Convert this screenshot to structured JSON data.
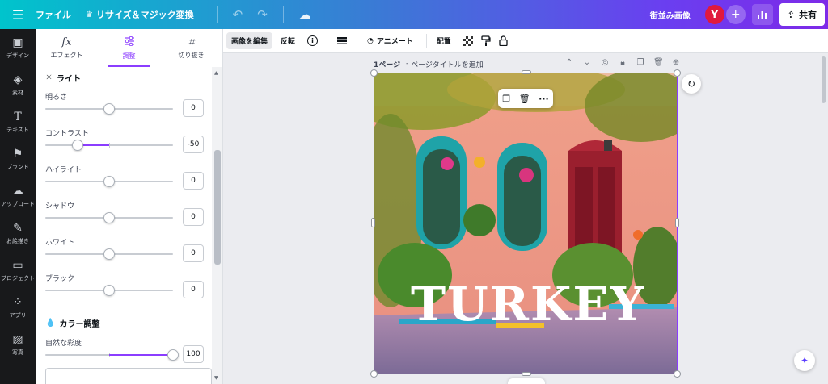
{
  "topbar": {
    "file_label": "ファイル",
    "resize_label": "リサイズ＆マジック変換",
    "design_title": "街並み画像",
    "avatar_initial": "Y",
    "share_label": "共有"
  },
  "rail": [
    {
      "label": "デザイン",
      "icon": "layout-icon"
    },
    {
      "label": "素材",
      "icon": "elements-icon"
    },
    {
      "label": "テキスト",
      "icon": "text-icon"
    },
    {
      "label": "ブランド",
      "icon": "brand-icon"
    },
    {
      "label": "アップロード",
      "icon": "upload-icon"
    },
    {
      "label": "お絵描き",
      "icon": "draw-icon"
    },
    {
      "label": "プロジェクト",
      "icon": "folder-icon"
    },
    {
      "label": "アプリ",
      "icon": "apps-icon"
    },
    {
      "label": "写真",
      "icon": "photo-icon"
    }
  ],
  "panel": {
    "tabs": [
      {
        "label": "エフェクト",
        "icon": "fx"
      },
      {
        "label": "調整",
        "icon": "sliders-icon"
      },
      {
        "label": "切り抜き",
        "icon": "crop-icon"
      }
    ],
    "active_tab": 1,
    "light_section": "ライト",
    "color_section": "カラー調整",
    "sliders": [
      {
        "label": "明るさ",
        "value": "0",
        "level": 0
      },
      {
        "label": "コントラスト",
        "value": "-50",
        "level": -50
      },
      {
        "label": "ハイライト",
        "value": "0",
        "level": 0
      },
      {
        "label": "シャドウ",
        "value": "0",
        "level": 0
      },
      {
        "label": "ホワイト",
        "value": "0",
        "level": 0
      },
      {
        "label": "ブラック",
        "value": "0",
        "level": 0
      }
    ],
    "color_sliders": [
      {
        "label": "自然な彩度",
        "value": "100",
        "level": 100
      }
    ]
  },
  "context_toolbar": {
    "edit_image": "画像を編集",
    "flip": "反転",
    "animate": "アニメート",
    "arrange": "配置"
  },
  "page": {
    "number_label": "1ページ",
    "title_placeholder": "ページタイトルを追加",
    "separator": " - "
  },
  "canvas": {
    "headline": "TURKEY",
    "accent": "#8b3dff"
  }
}
